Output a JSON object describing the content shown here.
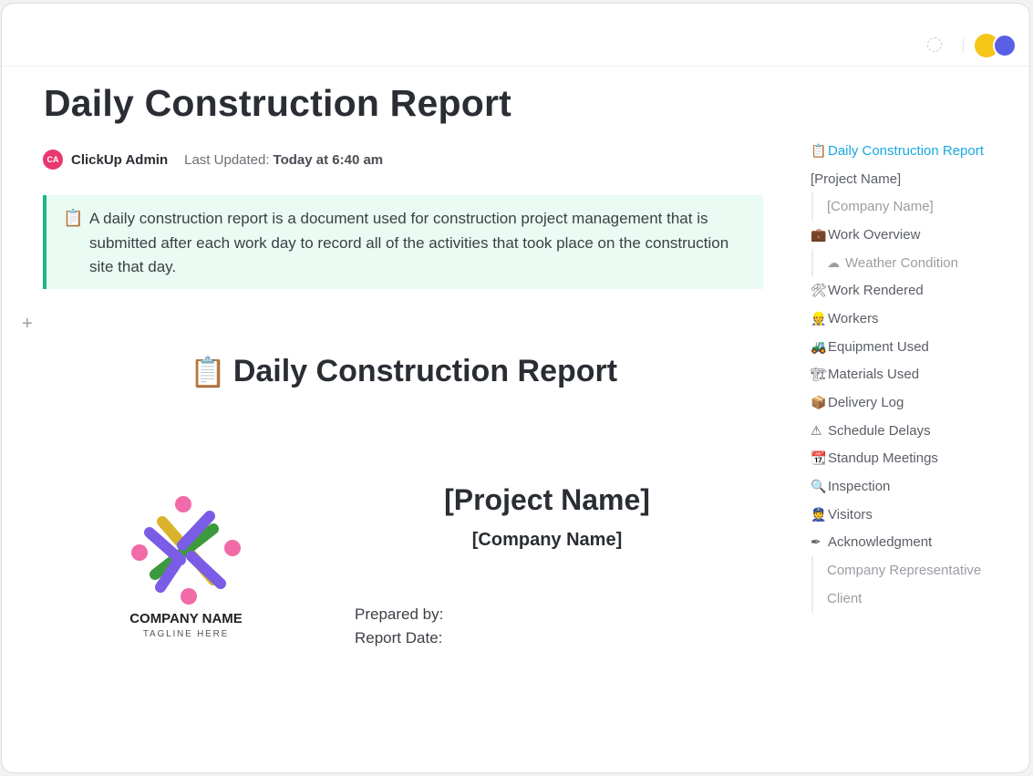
{
  "doc": {
    "title": "Daily Construction Report",
    "author_initials": "CA",
    "author": "ClickUp Admin",
    "updated_label": "Last Updated:",
    "updated_value": "Today at 6:40 am"
  },
  "callout": {
    "icon": "clipboard-icon",
    "text": "A daily construction report is a document used for construction project management that is submitted after each work day to record all of the activities that took place on the construction site that day."
  },
  "body": {
    "section_heading": "Daily Construction Report",
    "section_icon": "clipboard-icon",
    "company_name": "COMPANY NAME",
    "tagline": "TAGLINE HERE",
    "project_name": "[Project Name]",
    "company_placeholder": "[Company Name]",
    "prepared_by": "Prepared by:",
    "report_date": "Report Date:"
  },
  "toc": {
    "items": [
      {
        "label": "Daily Construction Report",
        "icon": "📋",
        "level": 0,
        "active": true
      },
      {
        "label": "[Project Name]",
        "icon": "",
        "level": 0
      },
      {
        "label": "[Company Name]",
        "icon": "",
        "level": 1
      },
      {
        "label": "Work Overview",
        "icon": "💼",
        "level": 0
      },
      {
        "label": "Weather Condition",
        "icon": "☁",
        "level": 1
      },
      {
        "label": "Work Rendered",
        "icon": "🛠",
        "level": 0
      },
      {
        "label": "Workers",
        "icon": "👷",
        "level": 0
      },
      {
        "label": "Equipment Used",
        "icon": "🚜",
        "level": 0
      },
      {
        "label": "Materials Used",
        "icon": "🏗",
        "level": 0
      },
      {
        "label": "Delivery Log",
        "icon": "📦",
        "level": 0
      },
      {
        "label": "Schedule Delays",
        "icon": "⚠",
        "level": 0
      },
      {
        "label": "Standup Meetings",
        "icon": "📆",
        "level": 0
      },
      {
        "label": "Inspection",
        "icon": "🔍",
        "level": 0
      },
      {
        "label": "Visitors",
        "icon": "👮",
        "level": 0
      },
      {
        "label": "Acknowledgment",
        "icon": "✒",
        "level": 0
      },
      {
        "label": "Company Representative",
        "icon": "",
        "level": 1
      },
      {
        "label": "Client",
        "icon": "",
        "level": 1
      }
    ]
  },
  "colors": {
    "accent": "#1aa8e0",
    "callout_bg": "#e9fbf2",
    "callout_border": "#1bb884",
    "avatar": "#e8386f"
  }
}
